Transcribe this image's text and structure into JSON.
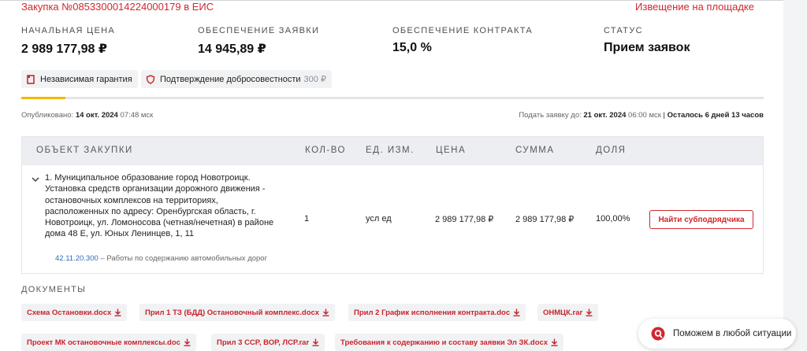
{
  "header": {
    "tender_link": "Закупка №0853300014224000179 в ЕИС",
    "notice_link": "Извещение на площадке"
  },
  "stats": [
    {
      "label": "НАЧАЛЬНАЯ ЦЕНА",
      "value": "2 989 177,98 ₽"
    },
    {
      "label": "ОБЕСПЕЧЕНИЕ ЗАЯВКИ",
      "value": "14 945,89 ₽"
    },
    {
      "label": "ОБЕСПЕЧЕНИЕ КОНТРАКТА",
      "value": "15,0 %"
    },
    {
      "label": "СТАТУС",
      "value": "Прием заявок"
    }
  ],
  "pills": {
    "guarantee": "Независимая гарантия",
    "integrity": "Подтверждение добросовестности",
    "integrity_price": "300 ₽"
  },
  "meta": {
    "published_label": "Опубликовано:",
    "published_date": "14 окт. 2024",
    "published_time": "07:48 мск",
    "deadline_label": "Подать заявку до:",
    "deadline_date": "21 окт. 2024",
    "deadline_time": "06:00 мск",
    "separator": "|",
    "remaining": "Осталось 6 дней 13 часов"
  },
  "table": {
    "headers": [
      "ОБЪЕКТ ЗАКУПКИ",
      "КОЛ-ВО",
      "ЕД. ИЗМ.",
      "ЦЕНА",
      "СУММА",
      "ДОЛЯ"
    ],
    "rows": [
      {
        "object": "1. Муниципальное образование город Новотроицк. Установка средств организации дорожного движения - остановочных комплексов на территориях, расположенных по адресу: Оренбургская область, г. Новотроицк, ул. Ломоносова (четная/нечетная) в районе дома 48 Е, ул. Юных Ленинцев, 1, 11",
        "code": "42.11.20.300",
        "code_desc": "– Работы по содержанию автомобильных дорог",
        "qty": "1",
        "unit": "усл ед",
        "price": "2 989 177,98 ₽",
        "sum": "2 989 177,98 ₽",
        "share": "100,00%",
        "button": "Найти субподрядчика"
      }
    ]
  },
  "documents": {
    "title": "ДОКУМЕНТЫ",
    "items": [
      "Схема Остановки.docx",
      "Прил 1 ТЗ (БДД) Остановочный комплекс.docx",
      "Прил 2 График исполнения контракта.doc",
      "ОНМЦК.rar",
      "Проект МК остановочные комплексы.doc",
      "Прил 3 ССР, ВОР, ЛСР.rar",
      "Требования к содержанию и составу заявки Эл ЗК.docx"
    ]
  },
  "help": {
    "label": "Поможем в любой ситуации"
  },
  "colors": {
    "accent_red": "#d0282e",
    "tab_yellow": "#f2b705",
    "code_blue": "#2a6db5"
  }
}
